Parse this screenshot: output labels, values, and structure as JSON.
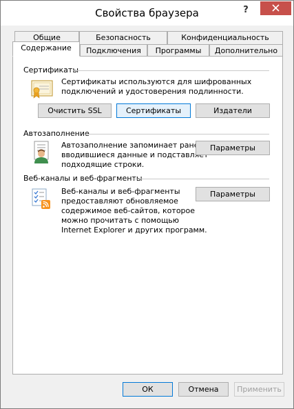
{
  "window": {
    "title": "Свойства браузера",
    "help_glyph": "?",
    "close_glyph": "close"
  },
  "tabs": {
    "row1": [
      "Общие",
      "Безопасность",
      "Конфиденциальность"
    ],
    "row2": [
      "Содержание",
      "Подключения",
      "Программы",
      "Дополнительно"
    ],
    "active": "Содержание"
  },
  "certificates": {
    "title": "Сертификаты",
    "description": "Сертификаты используются для шифрованных подключений и удостоверения подлинности.",
    "desc_line1": "Сертификаты используются для шифрованных",
    "desc_line2": "подключений и удостоверения подлинности.",
    "clear_ssl_label": "Очистить SSL",
    "certificates_label": "Сертификаты",
    "publishers_label": "Издатели"
  },
  "autocomplete": {
    "title": "Автозаполнение",
    "desc_line1": "Автозаполнение запоминает ранее",
    "desc_line2": "вводившиеся данные и подставляет",
    "desc_line3": "подходящие строки.",
    "settings_label": "Параметры"
  },
  "feeds": {
    "title": "Веб-каналы и веб-фрагменты",
    "desc_line1": "Веб-каналы и веб-фрагменты",
    "desc_line2": "предоставляют обновляемое",
    "desc_line3": "содержимое веб-сайтов, которое",
    "desc_line4": "можно прочитать с помощью",
    "desc_line5": "Internet Explorer и других программ.",
    "settings_label": "Параметры"
  },
  "footer": {
    "ok_label": "ОК",
    "cancel_label": "Отмена",
    "apply_label": "Применить"
  },
  "colors": {
    "close_button": "#c7504b",
    "focus_border": "#0078d7",
    "rss_orange": "#f7921e"
  }
}
